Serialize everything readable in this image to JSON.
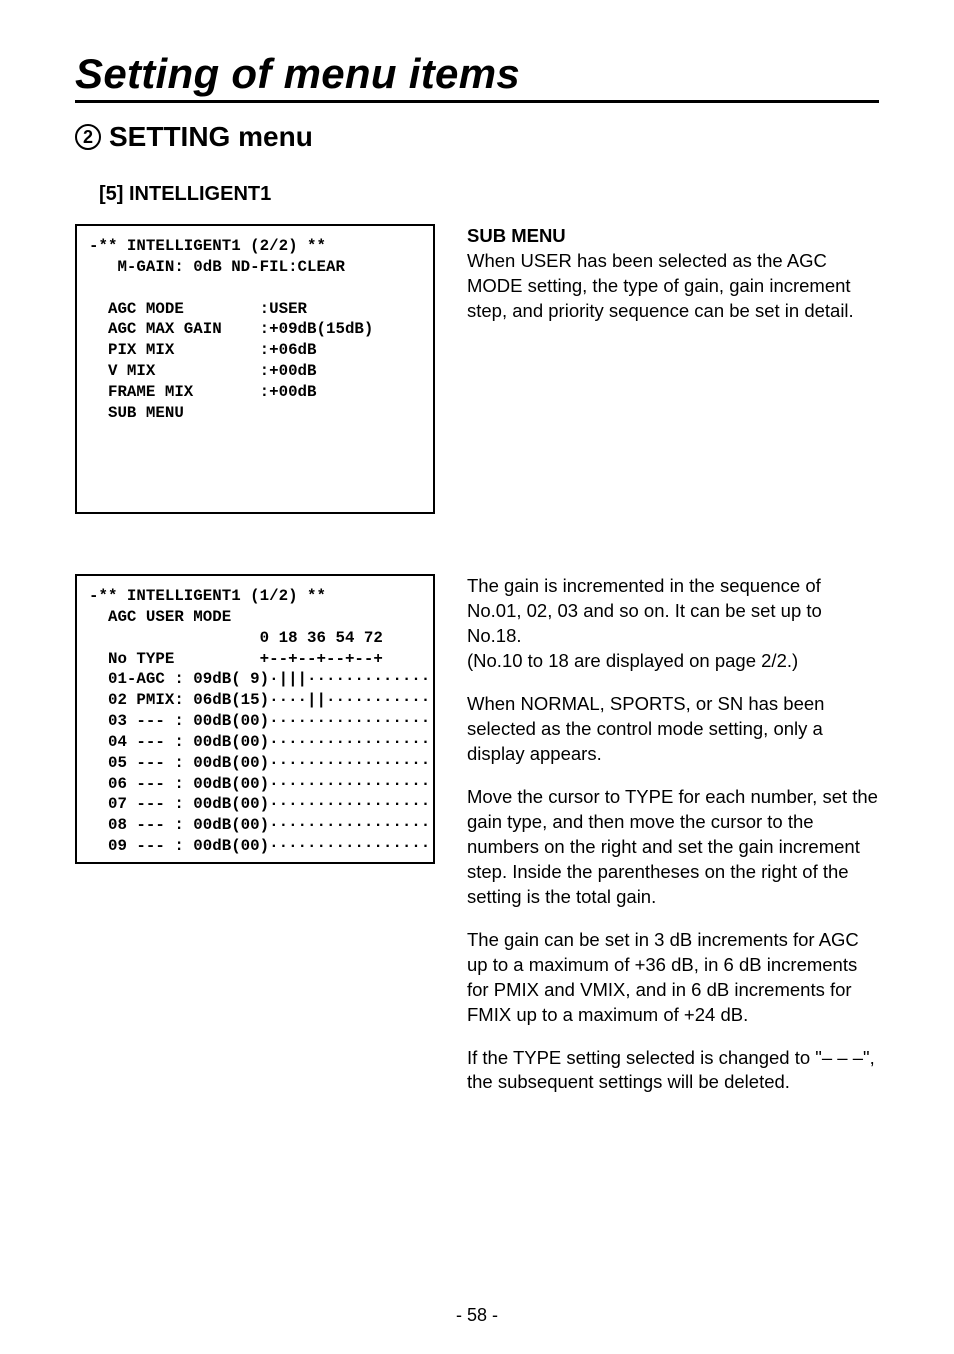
{
  "title": "Setting of menu items",
  "section": {
    "number": "2",
    "heading": "SETTING menu"
  },
  "subheading": "[5] INTELLIGENT1",
  "screen1": "-** INTELLIGENT1 (2/2) **\n   M-GAIN: 0dB ND-FIL:CLEAR\n\n  AGC MODE        :USER\n  AGC MAX GAIN    :+09dB(15dB)\n  PIX MIX         :+06dB\n  V MIX           :+00dB\n  FRAME MIX       :+00dB\n  SUB MENU",
  "submenu": {
    "title": "SUB MENU",
    "body": "When USER has been selected as the AGC MODE setting, the type of gain, gain increment step, and priority sequence can be set in detail."
  },
  "screen2": "-** INTELLIGENT1 (1/2) **\n  AGC USER MODE\n                  0 18 36 54 72\n  No TYPE         +--+--+--+--+\n  01-AGC : 09dB( 9)·|||··············\n  02 PMIX: 06dB(15)····||············\n  03 --- : 00dB(00)··················\n  04 --- : 00dB(00)··················\n  05 --- : 00dB(00)··················\n  06 --- : 00dB(00)··················\n  07 --- : 00dB(00)··················\n  08 --- : 00dB(00)··················\n  09 --- : 00dB(00)··················",
  "detail": {
    "p1": "The gain is incremented in the sequence of No.01, 02, 03 and so on. It can be set up to No.18.",
    "p1b": "(No.10 to 18 are displayed on page 2/2.)",
    "p2": "When NORMAL, SPORTS, or SN has been selected as the control mode setting, only a display appears.",
    "p3": "Move the cursor to TYPE for each number, set the gain type, and then move the cursor to the numbers on the right and set the gain increment step. Inside the parentheses on the right of the setting is the total gain.",
    "p4": "The gain can be set in 3 dB increments for AGC up to a maximum of +36 dB, in 6 dB increments for PMIX and VMIX, and in 6 dB increments for FMIX up to a maximum of +24 dB.",
    "p5": "If the TYPE setting selected is changed to \"– – –\", the subsequent settings will be deleted."
  },
  "pagenum": "- 58 -"
}
